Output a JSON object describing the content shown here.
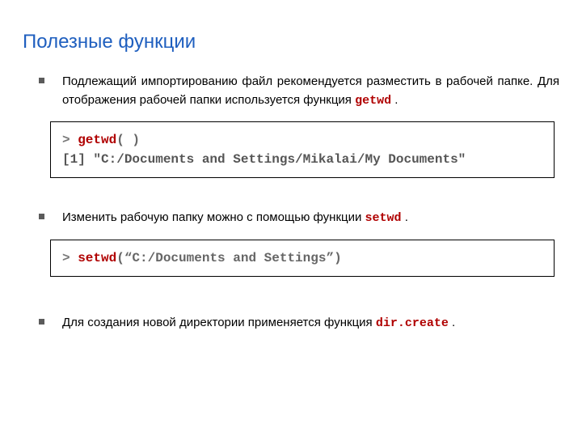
{
  "title": "Полезные функции",
  "bullets": {
    "b1_pre": "Подлежащий импортированию файл рекомендуется разместить в рабочей папке.  Для отображения рабочей папки используется функция ",
    "b1_fn": "getwd",
    "b1_post": " .",
    "b2_pre": "Изменить рабочую папку можно с помощью функции ",
    "b2_fn": "setwd",
    "b2_post": " .",
    "b3_pre": "Для создания новой директории применяется функция ",
    "b3_fn": "dir.create",
    "b3_post": " ."
  },
  "code1": {
    "prompt": "> ",
    "fn": "getwd",
    "args": "( )",
    "out": "[1] \"C:/Documents and Settings/Mikalai/My Documents\""
  },
  "code2": {
    "prompt": "> ",
    "fn": "setwd",
    "args": "(“C:/Documents and Settings”)"
  }
}
